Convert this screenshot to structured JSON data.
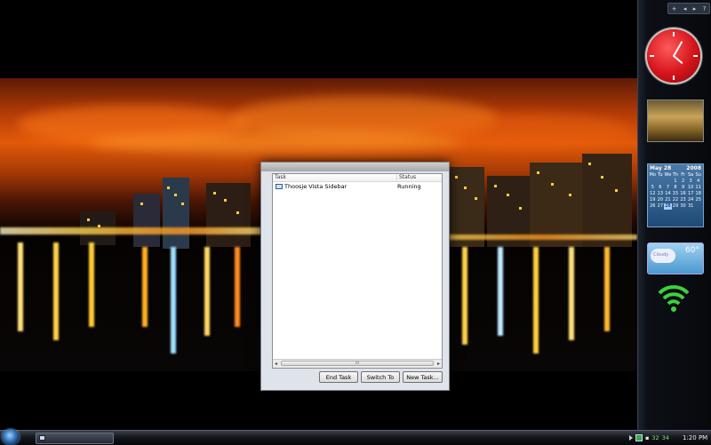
{
  "task_manager": {
    "columns": [
      "Task",
      "Status"
    ],
    "rows": [
      {
        "task": "Thoosje Vista Sidebar",
        "status": "Running"
      }
    ],
    "scroll_thumb_label": "III",
    "buttons": {
      "end_task": "End Task",
      "switch_to": "Switch To",
      "new_task": "New Task..."
    }
  },
  "sidebar": {
    "controls": [
      "+",
      "◂",
      "▸",
      "?"
    ],
    "calendar": {
      "month_label": "May 28",
      "year_label": "2008",
      "weekdays": [
        "Mo",
        "Tu",
        "We",
        "Th",
        "Fr",
        "Sa",
        "Su"
      ],
      "days": [
        "",
        "",
        "",
        "1",
        "2",
        "3",
        "4",
        "5",
        "6",
        "7",
        "8",
        "9",
        "10",
        "11",
        "12",
        "13",
        "14",
        "15",
        "16",
        "17",
        "18",
        "19",
        "20",
        "21",
        "22",
        "23",
        "24",
        "25",
        "26",
        "27",
        "28",
        "29",
        "30",
        "31",
        ""
      ]
    },
    "weather": {
      "temp": "60°",
      "condition_label": "Cloudy"
    }
  },
  "taskbar": {
    "tray_numbers": [
      "32",
      "34"
    ],
    "time": "1:20 PM"
  },
  "colors": {
    "accent": "#e25a08",
    "clock_face": "#d4141a",
    "signal": "#3fcf3f"
  }
}
